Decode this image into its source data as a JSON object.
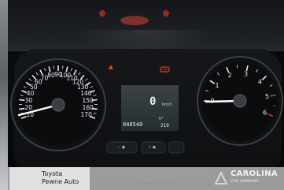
{
  "speedometer": {
    "ticks": [
      "10",
      "20",
      "30",
      "40",
      "50",
      "60",
      "70",
      "80",
      "90",
      "100",
      "110",
      "120",
      "130",
      "140",
      "150",
      "160",
      "170"
    ],
    "unit": "km/h"
  },
  "tachometer": {
    "ticks": [
      "0",
      "1",
      "2",
      "3",
      "4",
      "5",
      "6"
    ]
  },
  "display": {
    "speed": "0",
    "unit": "km/h",
    "odometer": "048540",
    "trip": "210",
    "temperature": "6°"
  },
  "watermark": {
    "brand_line1": "Toyota",
    "brand_line2": "Pewne Auto",
    "dealer": "CAROLINA",
    "dealer_sub": "CAR COMPANY",
    "center_text": "INDYWIDUALNA OFERTA"
  },
  "colors": {
    "needle": "#ffffff",
    "warning": "#e63d24",
    "backlight": "#e9edf2",
    "redzone": "#d8342b"
  },
  "icons": [
    "steering-warning-icon",
    "parking-brake-icon",
    "fuel-icon"
  ]
}
